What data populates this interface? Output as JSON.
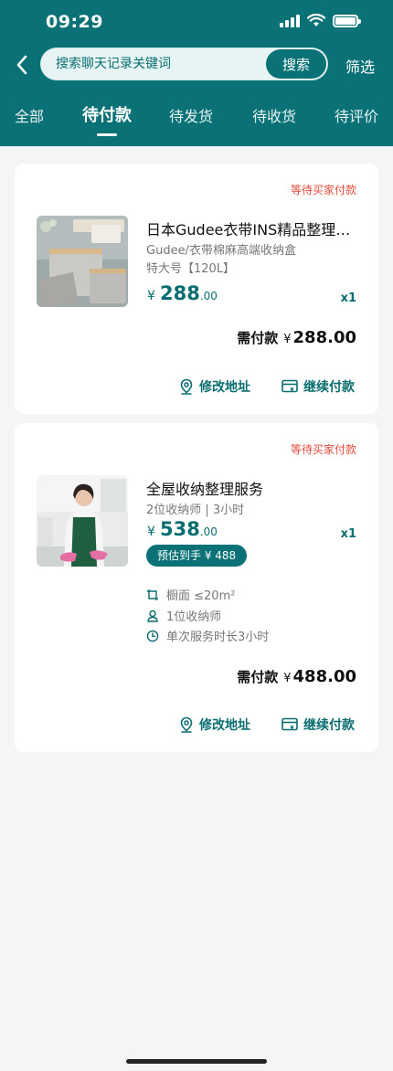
{
  "status_bar": {
    "time": "09:29"
  },
  "search": {
    "placeholder": "搜索聊天记录关键词",
    "button_label": "搜索",
    "filter_label": "筛选"
  },
  "tabs": [
    {
      "label": "全部"
    },
    {
      "label": "待付款"
    },
    {
      "label": "待发货"
    },
    {
      "label": "待收货"
    },
    {
      "label": "待评价"
    }
  ],
  "active_tab": "待付款",
  "orders": [
    {
      "status": "等待买家付款",
      "title": "日本Gudee衣带INS精品整理箱收纳",
      "subtitle": "Gudee/衣带棉麻高端收纳盒",
      "spec": "特大号【120L】",
      "currency": "¥",
      "price_int": "288",
      "price_dec": ".00",
      "quantity": "x1",
      "total_label": "需付款",
      "total_amount": "288.00",
      "actions": [
        "修改地址",
        "继续付款"
      ]
    },
    {
      "status": "等待买家付款",
      "title": "全屋收纳整理服务",
      "subtitle": "2位收纳师 | 3小时",
      "currency": "¥",
      "price_int": "538",
      "price_dec": ".00",
      "quantity": "x1",
      "estimate_badge": "预估到手 ¥ 488",
      "specs": [
        {
          "icon": "area-icon",
          "text": "橱面 ≤20m²"
        },
        {
          "icon": "person-icon",
          "text": "1位收纳师"
        },
        {
          "icon": "clock-icon",
          "text": "单次服务时长3小时"
        }
      ],
      "total_label": "需付款",
      "total_amount": "488.00",
      "actions": [
        "修改地址",
        "继续付款"
      ]
    }
  ],
  "colors": {
    "brand": "#0a7176",
    "status_red": "#e44a3b",
    "background": "#f5f5f5"
  }
}
